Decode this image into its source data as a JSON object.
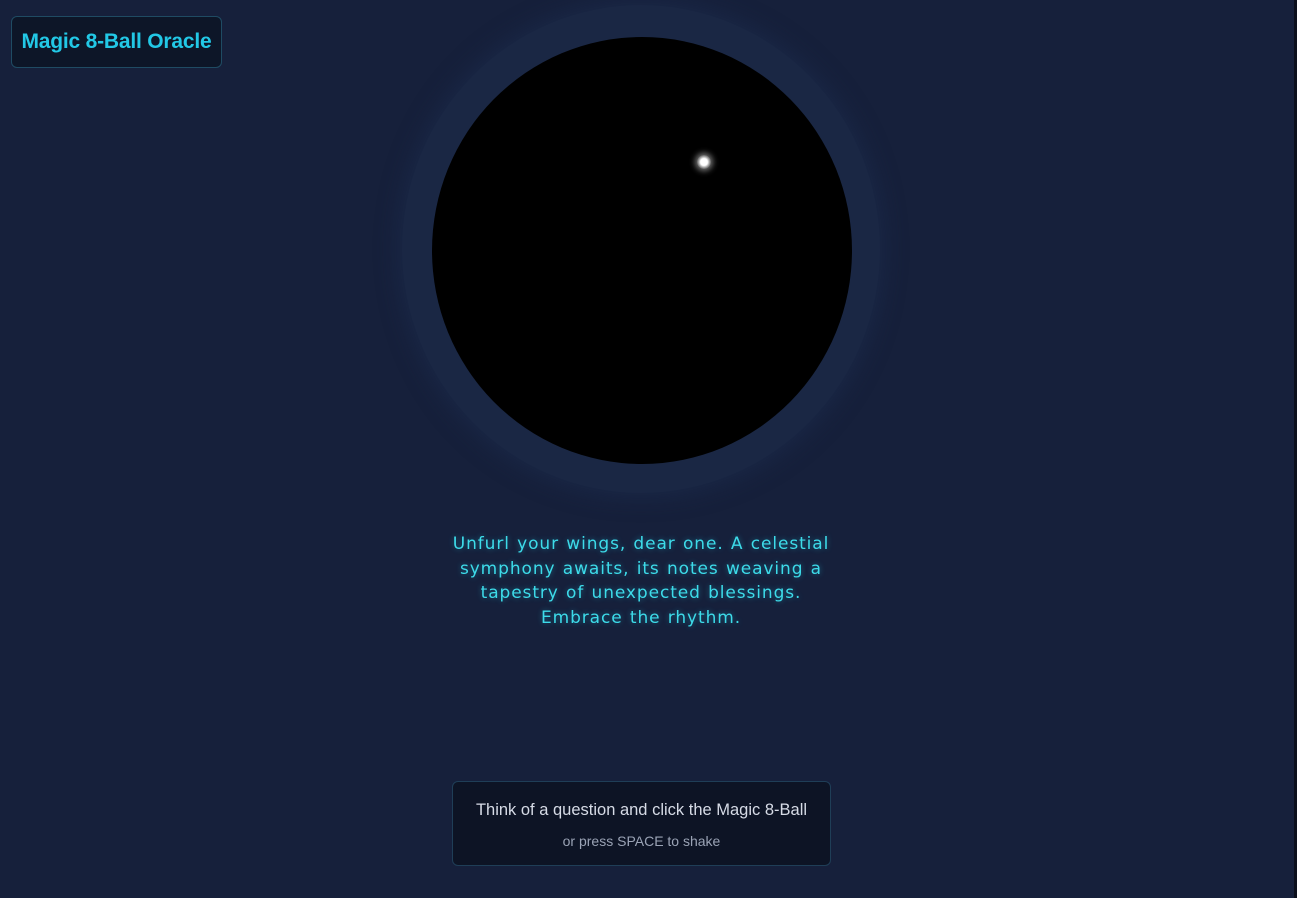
{
  "app": {
    "title": "Magic 8-Ball Oracle"
  },
  "oracle": {
    "answer": "Unfurl your wings, dear one.  A celestial symphony awaits, its notes weaving a tapestry of unexpected blessings. Embrace the rhythm."
  },
  "instructions": {
    "main": "Think of a question and click the Magic 8-Ball",
    "sub": "or press SPACE to shake"
  },
  "colors": {
    "background": "#16203b",
    "accent": "#22c8e6",
    "answer_text": "#3ddbe9",
    "ball": "#000000"
  }
}
